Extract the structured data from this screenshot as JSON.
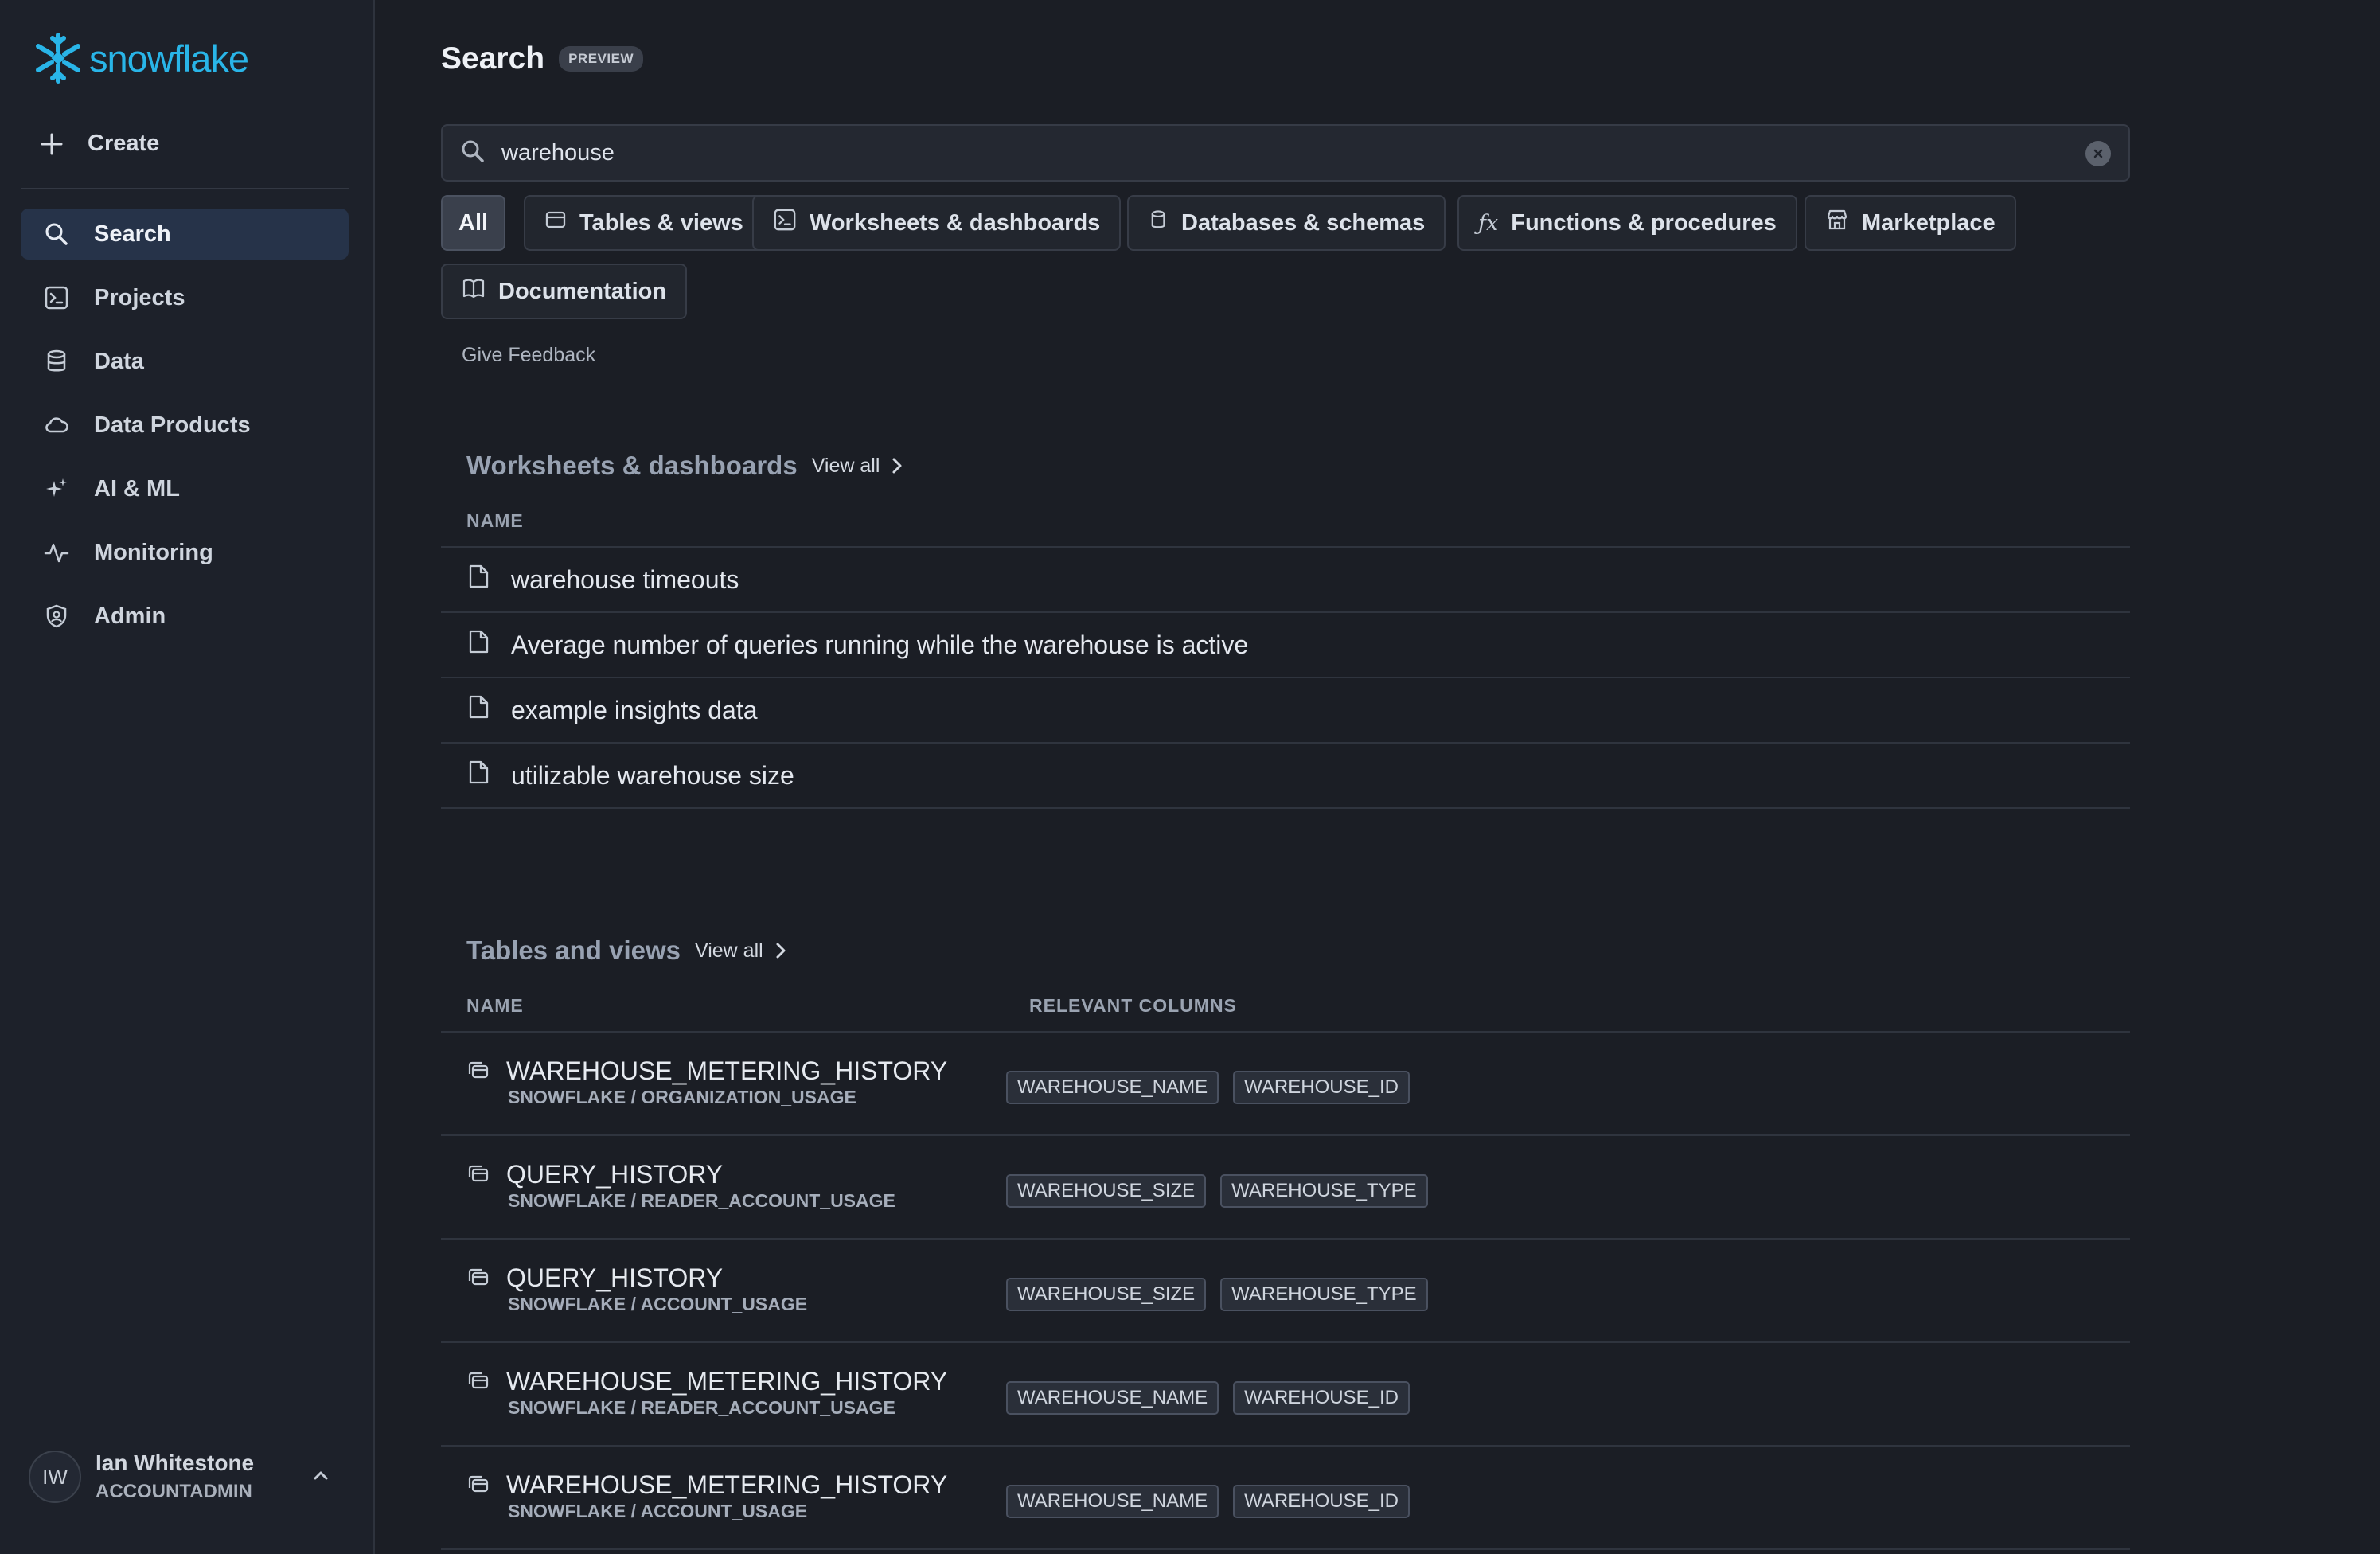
{
  "brand": {
    "name": "snowflake",
    "color": "#29b5e8"
  },
  "sidebar": {
    "create_label": "Create",
    "items": [
      {
        "label": "Search",
        "icon": "search-icon",
        "active": true
      },
      {
        "label": "Projects",
        "icon": "terminal-icon"
      },
      {
        "label": "Data",
        "icon": "database-icon"
      },
      {
        "label": "Data Products",
        "icon": "cloud-icon"
      },
      {
        "label": "AI & ML",
        "icon": "sparkle-icon"
      },
      {
        "label": "Monitoring",
        "icon": "activity-icon"
      },
      {
        "label": "Admin",
        "icon": "shield-icon"
      }
    ],
    "user": {
      "initials": "IW",
      "name": "Ian Whitestone",
      "role": "ACCOUNTADMIN"
    }
  },
  "header": {
    "title": "Search",
    "badge": "PREVIEW"
  },
  "search": {
    "value": "warehouse"
  },
  "filters": [
    {
      "label": "All",
      "icon": "",
      "active": true
    },
    {
      "label": "Tables & views",
      "icon": "table-icon"
    },
    {
      "label": "Worksheets & dashboards",
      "icon": "terminal-icon"
    },
    {
      "label": "Databases & schemas",
      "icon": "database-icon"
    },
    {
      "label": "Functions & procedures",
      "icon": "function-icon"
    },
    {
      "label": "Marketplace",
      "icon": "store-icon"
    },
    {
      "label": "Documentation",
      "icon": "book-icon"
    }
  ],
  "feedback_label": "Give Feedback",
  "worksheets": {
    "title": "Worksheets & dashboards",
    "view_all": "View all",
    "column_name": "NAME",
    "rows": [
      "warehouse timeouts",
      "Average number of queries running while the warehouse is active",
      "example insights data",
      "utilizable warehouse size"
    ]
  },
  "tables": {
    "title": "Tables and views",
    "view_all": "View all",
    "column_name": "NAME",
    "column_relevant": "RELEVANT COLUMNS",
    "rows": [
      {
        "name": "WAREHOUSE_METERING_HISTORY",
        "path": "SNOWFLAKE / ORGANIZATION_USAGE",
        "tags": [
          "WAREHOUSE_NAME",
          "WAREHOUSE_ID"
        ]
      },
      {
        "name": "QUERY_HISTORY",
        "path": "SNOWFLAKE / READER_ACCOUNT_USAGE",
        "tags": [
          "WAREHOUSE_SIZE",
          "WAREHOUSE_TYPE"
        ]
      },
      {
        "name": "QUERY_HISTORY",
        "path": "SNOWFLAKE / ACCOUNT_USAGE",
        "tags": [
          "WAREHOUSE_SIZE",
          "WAREHOUSE_TYPE"
        ]
      },
      {
        "name": "WAREHOUSE_METERING_HISTORY",
        "path": "SNOWFLAKE / READER_ACCOUNT_USAGE",
        "tags": [
          "WAREHOUSE_NAME",
          "WAREHOUSE_ID"
        ]
      },
      {
        "name": "WAREHOUSE_METERING_HISTORY",
        "path": "SNOWFLAKE / ACCOUNT_USAGE",
        "tags": [
          "WAREHOUSE_NAME",
          "WAREHOUSE_ID"
        ]
      }
    ]
  }
}
